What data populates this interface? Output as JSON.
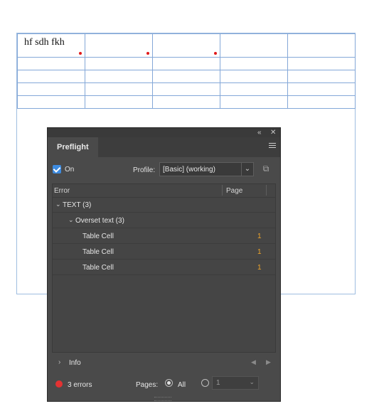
{
  "document": {
    "table": {
      "rows": [
        [
          "hf sdh fkh",
          "",
          "",
          "",
          ""
        ],
        [
          "",
          "",
          "",
          "",
          ""
        ],
        [
          "",
          "",
          "",
          "",
          ""
        ],
        [
          "",
          "",
          "",
          "",
          ""
        ],
        [
          "",
          "",
          "",
          "",
          ""
        ]
      ],
      "overset_cells_in_first_row": 3,
      "overset_marker_color": "#e11a1a"
    }
  },
  "panel": {
    "tab_label": "Preflight",
    "collapse_icon": "double-chevron-left-icon",
    "close_icon": "close-icon",
    "menu_icon": "hamburger-menu-icon",
    "on": {
      "checked": true,
      "label": "On"
    },
    "profile": {
      "label": "Profile:",
      "value": "[Basic] (working)",
      "button_icon": "define-profiles-icon"
    },
    "columns": {
      "error": "Error",
      "page": "Page"
    },
    "errors": [
      {
        "level": 0,
        "label": "TEXT (3)",
        "expanded": true
      },
      {
        "level": 1,
        "label": "Overset text (3)",
        "expanded": true
      },
      {
        "level": 2,
        "label": "Table Cell",
        "page": "1"
      },
      {
        "level": 2,
        "label": "Table Cell",
        "page": "1"
      },
      {
        "level": 2,
        "label": "Table Cell",
        "page": "1"
      }
    ],
    "info": {
      "label": "Info",
      "expanded": false
    },
    "status": {
      "text": "3 errors",
      "color": "#e33232"
    },
    "pages": {
      "label": "Pages:",
      "all_label": "All",
      "selected": "All",
      "range_value": "1"
    },
    "colors": {
      "accent": "#3d8be0",
      "page_number": "#f0a52a"
    }
  }
}
